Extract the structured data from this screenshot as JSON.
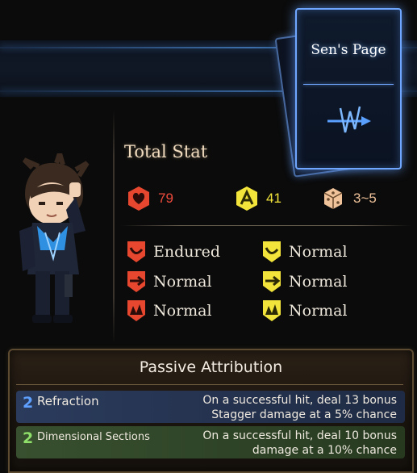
{
  "page": {
    "title": "Sen's Page"
  },
  "total_stat": {
    "label": "Total Stat",
    "hp": {
      "icon": "hp-heart-icon",
      "value": "79",
      "color": "#ef4b3c"
    },
    "stagger": {
      "icon": "stagger-resist-icon",
      "value": "41",
      "color": "#f2e43a"
    },
    "speed": {
      "icon": "speed-dice-icon",
      "value": "3~5",
      "color": "#f0c39a"
    }
  },
  "resistances": {
    "physical": [
      {
        "type": "slash",
        "icon": "slash-resist-icon",
        "value": "Endured"
      },
      {
        "type": "pierce",
        "icon": "pierce-resist-icon",
        "value": "Normal"
      },
      {
        "type": "blunt",
        "icon": "blunt-resist-icon",
        "value": "Normal"
      }
    ],
    "stagger": [
      {
        "type": "slash",
        "icon": "slash-stagger-icon",
        "value": "Normal"
      },
      {
        "type": "pierce",
        "icon": "pierce-stagger-icon",
        "value": "Normal"
      },
      {
        "type": "blunt",
        "icon": "blunt-stagger-icon",
        "value": "Normal"
      }
    ],
    "colors": {
      "physical": "#e8472f",
      "stagger": "#f2e43a"
    }
  },
  "passive": {
    "title": "Passive Attribution",
    "items": [
      {
        "cost": "2",
        "name": "Refraction",
        "desc1": "On a successful hit, deal 13 bonus",
        "desc2": "Stagger damage at a 5% chance",
        "bg": "#26344f",
        "cost_color": "#5ea0ff"
      },
      {
        "cost": "2",
        "name": "Dimensional Sections",
        "desc1": "On a successful hit, deal 10 bonus",
        "desc2": "damage at a 10% chance",
        "bg": "#31452a",
        "cost_color": "#8ee06a"
      }
    ]
  }
}
